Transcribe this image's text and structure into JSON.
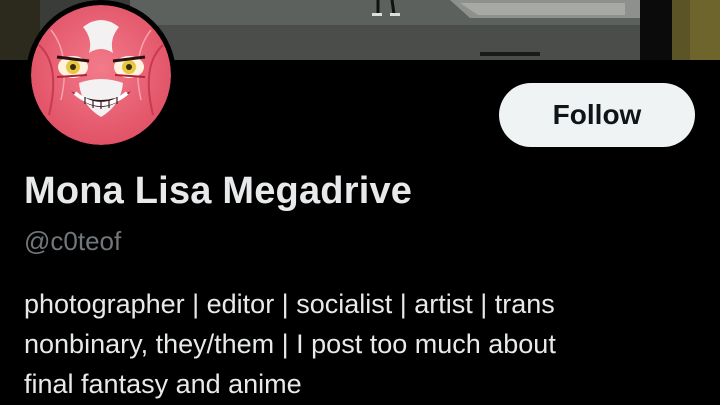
{
  "profile": {
    "display_name": "Mona Lisa Megadrive",
    "handle": "@c0teof",
    "bio_lines": [
      "photographer | editor | socialist | artist | trans",
      "nonbinary, they/them | I post too much about",
      "final fantasy and anime"
    ]
  },
  "actions": {
    "follow_label": "Follow"
  },
  "colors": {
    "background": "#000000",
    "text_primary": "#e7e9ea",
    "text_secondary": "#71767b",
    "button_bg": "#eff3f4",
    "button_text": "#0f1419",
    "avatar_bg": "#e85a6e"
  },
  "icons": {
    "avatar": "pink-grinning-demon-face-avatar"
  }
}
